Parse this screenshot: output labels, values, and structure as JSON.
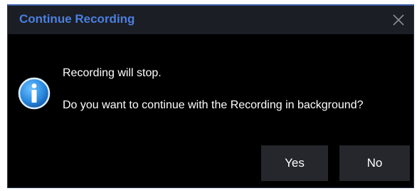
{
  "dialog": {
    "title": "Continue Recording",
    "close_icon": "close-icon",
    "info_icon": "info-icon",
    "message_line1": "Recording will stop.",
    "message_line2": "Do you want to continue with the Recording in background?",
    "buttons": {
      "yes_label": "Yes",
      "no_label": "No"
    }
  },
  "colors": {
    "title": "#4a7fe0",
    "background": "#000000",
    "titlebar": "#1b1e24",
    "button": "#25272c",
    "info_icon": "#2a8be0"
  }
}
